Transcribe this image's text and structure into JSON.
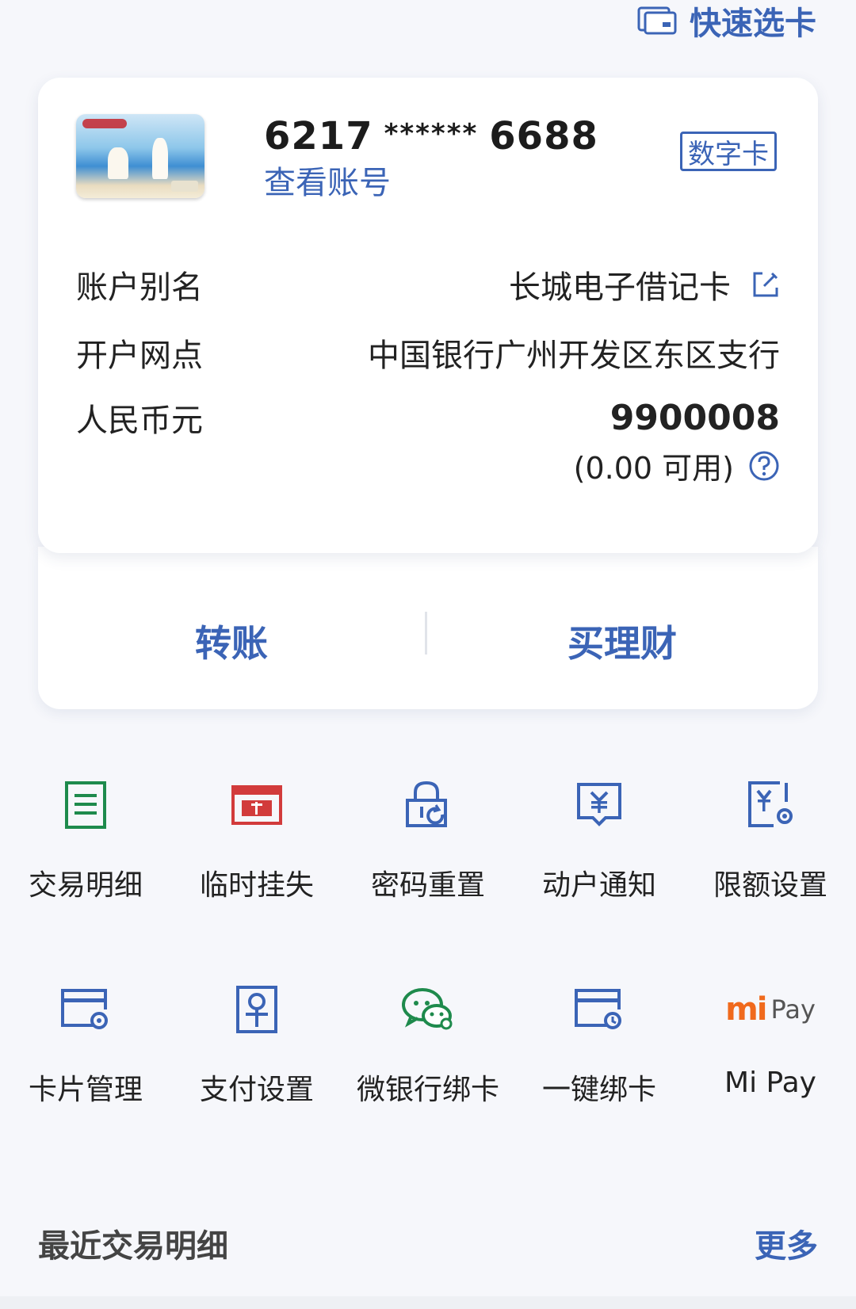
{
  "header": {
    "quick_select_label": "快速选卡"
  },
  "card": {
    "number_prefix": "6217",
    "number_mask": "******",
    "number_suffix": "6688",
    "view_account_label": "查看账号",
    "digital_badge": "数字卡"
  },
  "details": {
    "alias_label": "账户别名",
    "alias_value": "长城电子借记卡",
    "branch_label": "开户网点",
    "branch_value": "中国银行广州开发区东区支行",
    "currency_label": "人民币元",
    "balance_value": "9900008",
    "available_value": "(0.00 可用)"
  },
  "actions": {
    "transfer_label": "转账",
    "wealth_label": "买理财"
  },
  "services": [
    {
      "label": "交易明细",
      "icon": "transaction-detail-icon"
    },
    {
      "label": "临时挂失",
      "icon": "temporary-loss-report-icon"
    },
    {
      "label": "密码重置",
      "icon": "password-reset-icon"
    },
    {
      "label": "动户通知",
      "icon": "account-notification-icon"
    },
    {
      "label": "限额设置",
      "icon": "limit-settings-icon"
    },
    {
      "label": "卡片管理",
      "icon": "card-management-icon"
    },
    {
      "label": "支付设置",
      "icon": "payment-settings-icon"
    },
    {
      "label": "微银行绑卡",
      "icon": "wechat-bank-bind-icon"
    },
    {
      "label": "一键绑卡",
      "icon": "one-click-bind-icon"
    },
    {
      "label": "Mi Pay",
      "icon": "mi-pay-icon",
      "logo_text_mi": "mi",
      "logo_text_pay": "Pay"
    }
  ],
  "recent": {
    "title": "最近交易明细",
    "more_label": "更多"
  },
  "colors": {
    "accent": "#3b64b6",
    "green": "#1e8a4c",
    "red": "#d23b3b",
    "orange": "#f06a1d"
  }
}
